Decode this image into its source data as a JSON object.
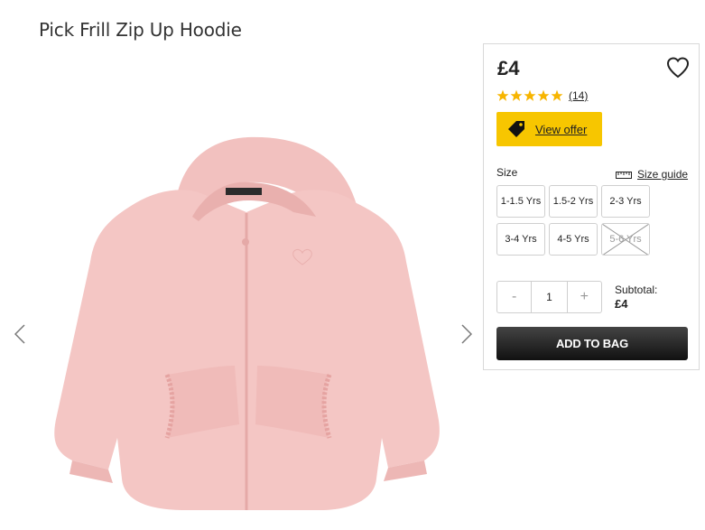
{
  "product": {
    "title": "Pick Frill Zip Up Hoodie",
    "image_alt": "Pink frill zip up hoodie",
    "image_colors": {
      "body": "#f4c6c4",
      "shadow": "#e9b0ae",
      "label": "#2b2b2b"
    }
  },
  "gallery": {
    "prev_icon": "chevron-left-icon",
    "next_icon": "chevron-right-icon"
  },
  "purchase": {
    "price": "£4",
    "wishlist_icon": "heart-icon",
    "rating": {
      "stars": 5,
      "max": 5,
      "reviews": "(14)",
      "color": "#f7b500"
    },
    "offer": {
      "label": "View offer",
      "icon": "tag-icon",
      "color": "#f7c600"
    },
    "size": {
      "label": "Size",
      "guide_label": "Size guide",
      "guide_icon": "ruler-icon",
      "options": [
        {
          "label": "1-1.5 Yrs",
          "available": true
        },
        {
          "label": "1.5-2 Yrs",
          "available": true
        },
        {
          "label": "2-3 Yrs",
          "available": true
        },
        {
          "label": "3-4 Yrs",
          "available": true
        },
        {
          "label": "4-5 Yrs",
          "available": true
        },
        {
          "label": "5-6 Yrs",
          "available": false
        }
      ]
    },
    "quantity": {
      "minus": "-",
      "value": "1",
      "plus": "+"
    },
    "subtotal": {
      "label": "Subtotal:",
      "value": "£4"
    },
    "add_to_bag": "ADD TO BAG"
  }
}
